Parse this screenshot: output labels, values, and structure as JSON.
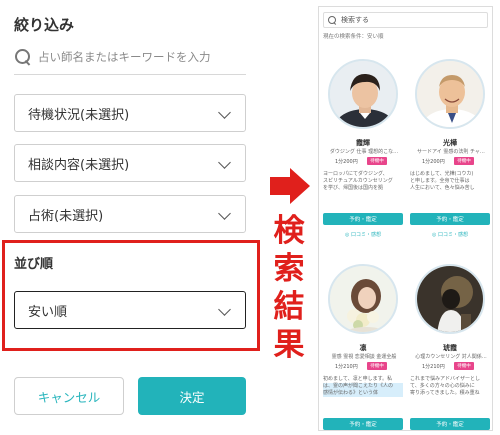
{
  "filter": {
    "title": "絞り込み",
    "search_placeholder": "占い師名またはキーワードを入力",
    "dropdowns": [
      {
        "label": "待機状況(未選択)"
      },
      {
        "label": "相談内容(未選択)"
      },
      {
        "label": "占術(未選択)"
      }
    ],
    "sort": {
      "label": "並び順",
      "value": "安い順"
    },
    "cancel_label": "キャンセル",
    "confirm_label": "決定"
  },
  "annotation": {
    "chars": [
      "検",
      "索",
      "結",
      "果"
    ],
    "color": "#e0201c"
  },
  "results": {
    "search_label": "検索する",
    "condition_text": "現在の検索条件：安い順",
    "cards": [
      {
        "name": "霞輝",
        "sub": "ダウジング 仕事 理想的こな…",
        "price": "1分200円",
        "badge": "待機中",
        "desc": [
          "ヨーロッパにてダウジング、",
          "スピリチュアルカウンセリング",
          "を学び、帰国後は国内を拠"
        ],
        "button": "予約・鑑定",
        "review": "◎ 口コミ・感想"
      },
      {
        "name": "光樺",
        "sub": "サードアイ 霊感の法則 チャ…",
        "price": "1分200円",
        "badge": "待機中",
        "desc": [
          "はじめまして、光樺(コウカ)",
          "と申します。全身で仕事は",
          "人生において、色々悩み苦し"
        ],
        "button": "予約・鑑定",
        "review": "◎ 口コミ・感想"
      },
      {
        "name": "凛",
        "sub": "霊感 霊視 恋愛相談 金運全般",
        "price": "1分210円",
        "badge": "待機中",
        "desc": [
          "初めまして、凛と申します。私",
          "は、霊の声が聞こえたり《人の",
          "感情が伝わる》という体"
        ],
        "button": "予約・鑑定",
        "review": ""
      },
      {
        "name": "琥霞",
        "sub": "心理カウンセリング 対人関係…",
        "price": "1分210円",
        "badge": "待機中",
        "desc": [
          "これまで悩みアドバイザーとし",
          "て、多くの方々の心の悩みに",
          "寄り添ってきました。積み重ね"
        ],
        "button": "予約・鑑定",
        "review": ""
      }
    ]
  },
  "colors": {
    "teal": "#22b3ba",
    "red": "#e0201c",
    "pink_badge": "#e8458b"
  }
}
